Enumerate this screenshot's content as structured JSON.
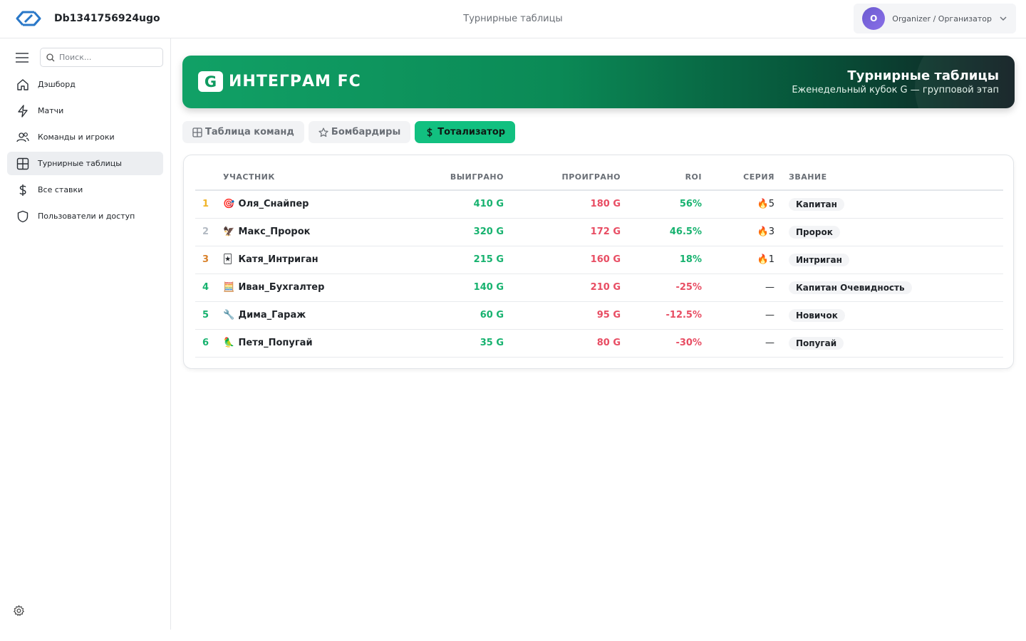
{
  "app": {
    "name": "Db1341756924ugo",
    "page_title": "Турнирные таблицы",
    "user": {
      "initial": "O",
      "role": "Organizer / Организатор"
    }
  },
  "sidebar": {
    "search_placeholder": "Поиск...",
    "items": [
      {
        "label": "Дэшборд",
        "icon": "home-icon"
      },
      {
        "label": "Матчи",
        "icon": "lightning-icon"
      },
      {
        "label": "Команды и игроки",
        "icon": "users-icon"
      },
      {
        "label": "Турнирные таблицы",
        "icon": "table-icon",
        "active": true
      },
      {
        "label": "Все ставки",
        "icon": "dollar-icon"
      },
      {
        "label": "Пользователи и доступ",
        "icon": "shield-icon"
      }
    ]
  },
  "banner": {
    "badge": "G",
    "name": "ИНТЕГРАМ FC",
    "title": "Турнирные таблицы",
    "subtitle": "Еженедельный кубок G — групповой этап"
  },
  "tabs": [
    {
      "label": "Таблица команд",
      "icon": "table-icon"
    },
    {
      "label": "Бомбардиры",
      "icon": "star-icon"
    },
    {
      "label": "Тотализатор",
      "icon": "dollar-icon",
      "active": true
    }
  ],
  "table": {
    "headers": [
      "УЧАСТНИК",
      "ВЫИГРАНО",
      "ПРОИГРАНО",
      "ROI",
      "СЕРИЯ",
      "ЗВАНИЕ"
    ],
    "rows": [
      {
        "rank": "1",
        "rank_color": "#f0b429",
        "emoji": "🎯",
        "name": "Оля_Снайпер",
        "won": "410 G",
        "lost": "180 G",
        "roi": "56%",
        "roi_sign": "pos",
        "streak": "🔥5",
        "title": "Капитан"
      },
      {
        "rank": "2",
        "rank_color": "#b3bac3",
        "emoji": "🦅",
        "name": "Макс_Пророк",
        "won": "320 G",
        "lost": "172 G",
        "roi": "46.5%",
        "roi_sign": "pos",
        "streak": "🔥3",
        "title": "Пророк"
      },
      {
        "rank": "3",
        "rank_color": "#d9822b",
        "emoji": "🃏",
        "name": "Катя_Интриган",
        "won": "215 G",
        "lost": "160 G",
        "roi": "18%",
        "roi_sign": "pos",
        "streak": "🔥1",
        "title": "Интриган"
      },
      {
        "rank": "4",
        "rank_color": "#17b26f",
        "emoji": "🧮",
        "name": "Иван_Бухгалтер",
        "won": "140 G",
        "lost": "210 G",
        "roi": "-25%",
        "roi_sign": "neg",
        "streak": "—",
        "title": "Капитан Очевидность"
      },
      {
        "rank": "5",
        "rank_color": "#17b26f",
        "emoji": "🔧",
        "name": "Дима_Гараж",
        "won": "60 G",
        "lost": "95 G",
        "roi": "-12.5%",
        "roi_sign": "neg",
        "streak": "—",
        "title": "Новичок"
      },
      {
        "rank": "6",
        "rank_color": "#17b26f",
        "emoji": "🦜",
        "name": "Петя_Попугай",
        "won": "35 G",
        "lost": "80 G",
        "roi": "-30%",
        "roi_sign": "neg",
        "streak": "—",
        "title": "Попугай"
      }
    ]
  },
  "colors": {
    "accent": "#12c080",
    "positive": "#17b26f",
    "negative": "#e84d63"
  }
}
